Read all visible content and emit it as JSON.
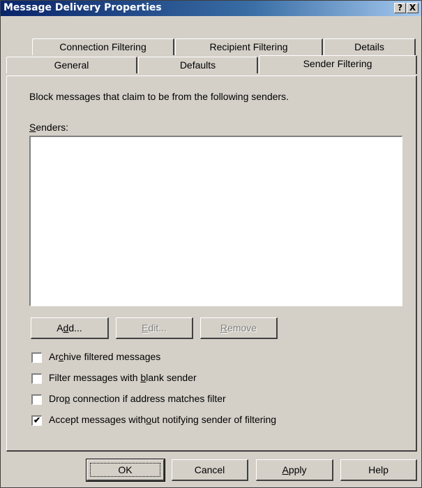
{
  "window": {
    "title": "Message Delivery Properties",
    "help_button": "?",
    "close_button": "X"
  },
  "tabs": {
    "row1": [
      "Connection Filtering",
      "Recipient Filtering",
      "Details"
    ],
    "row2": [
      "General",
      "Defaults",
      "Sender Filtering"
    ],
    "active": "Sender Filtering"
  },
  "panel": {
    "description": "Block messages that claim to be from the following senders.",
    "senders_label": "Senders:",
    "senders": []
  },
  "list_buttons": {
    "add": "Add...",
    "edit": "Edit...",
    "remove": "Remove"
  },
  "checkboxes": [
    {
      "label": "Archive filtered messages",
      "checked": false
    },
    {
      "label": "Filter messages with blank sender",
      "checked": false
    },
    {
      "label": "Drop connection if address matches filter",
      "checked": false
    },
    {
      "label": "Accept messages without notifying sender of filtering",
      "checked": true
    }
  ],
  "footer": {
    "ok": "OK",
    "cancel": "Cancel",
    "apply": "Apply",
    "help": "Help"
  },
  "colors": {
    "face": "#d4d0c8",
    "title_start": "#0a246a",
    "title_end": "#a6caf0"
  }
}
